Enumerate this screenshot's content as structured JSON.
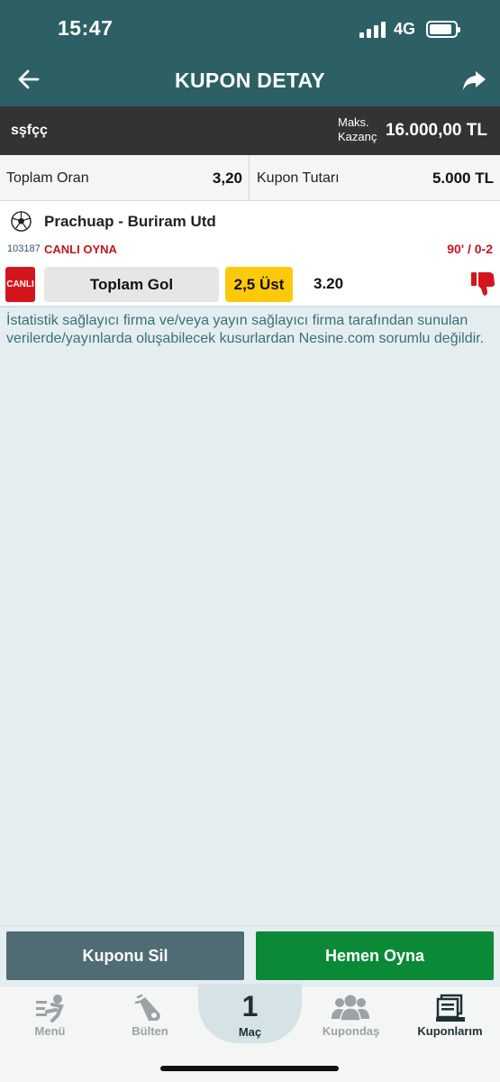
{
  "status": {
    "time": "15:47",
    "network": "4G"
  },
  "header": {
    "title": "KUPON DETAY"
  },
  "coupon": {
    "name": "sşfçç",
    "max_label": "Maks. Kazanç",
    "max_value": "16.000,00 TL"
  },
  "summary": {
    "total_odds_label": "Toplam Oran",
    "total_odds": "3,20",
    "amount_label": "Kupon Tutarı",
    "amount": "5.000 TL"
  },
  "match": {
    "teams": "Prachuap - Buriram Utd",
    "code": "103187",
    "live_play": "CANLI OYNA",
    "score": "90' / 0-2",
    "live_badge": "CANLI",
    "market": "Toplam Gol",
    "pick": "2,5 Üst",
    "odd": "3.20"
  },
  "disclaimer": "İstatistik sağlayıcı firma ve/veya yayın sağlayıcı firma tarafından sunulan verilerde/yayınlarda oluşabilecek kusurlardan Nesine.com sorumlu değildir.",
  "actions": {
    "delete_label": "Kuponu Sil",
    "play_label": "Hemen Oyna"
  },
  "tabs": [
    {
      "label": "Menü"
    },
    {
      "label": "Bülten"
    },
    {
      "label": "Maç",
      "count": "1"
    },
    {
      "label": "Kupondaş"
    },
    {
      "label": "Kuponlarım"
    }
  ],
  "colors": {
    "header_bg": "#2c6064",
    "live_red": "#c4161c",
    "pick_yellow": "#fdca0b",
    "play_green": "#0a8a36"
  }
}
